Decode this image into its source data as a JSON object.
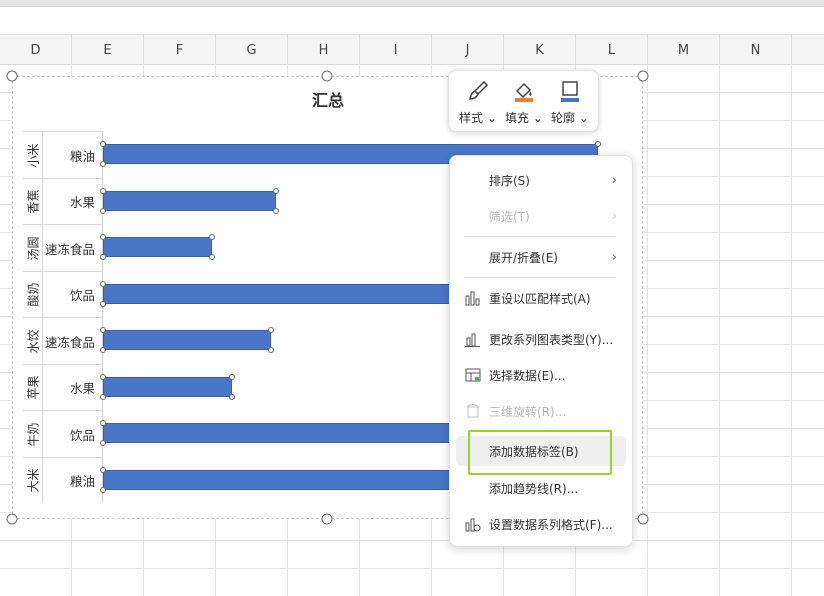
{
  "columns": [
    "D",
    "E",
    "F",
    "G",
    "H",
    "I",
    "J",
    "K",
    "L",
    "M",
    "N"
  ],
  "chart": {
    "title": "汇总",
    "groups": [
      {
        "outer": "小米",
        "inner": "粮油"
      },
      {
        "outer": "香蕉",
        "inner": "水果"
      },
      {
        "outer": "汤圆",
        "inner": "速冻食品"
      },
      {
        "outer": "酸奶",
        "inner": "饮品"
      },
      {
        "outer": "水饺",
        "inner": "速冻食品"
      },
      {
        "outer": "苹果",
        "inner": "水果"
      },
      {
        "outer": "牛奶",
        "inner": "饮品"
      },
      {
        "outer": "大米",
        "inner": "粮油"
      }
    ],
    "bar_color": "#4a76c8"
  },
  "chart_data": {
    "type": "bar",
    "title": "汇总",
    "categories": [
      "小米 粮油",
      "香蕉 水果",
      "汤圆 速冻食品",
      "酸奶 饮品",
      "水饺 速冻食品",
      "苹果 水果",
      "牛奶 饮品",
      "大米 粮油"
    ],
    "series": [
      {
        "values": [
          100,
          35,
          22,
          100,
          34,
          26,
          100,
          100
        ]
      }
    ],
    "note": ""
  },
  "float_toolbar": {
    "style": "样式",
    "fill": "填充",
    "outline": "轮廓",
    "fill_color": "#ed7d31",
    "outline_color": "#4472c4"
  },
  "context_menu": {
    "items": [
      {
        "label": "排序(S)",
        "icon": "none",
        "submenu": true,
        "disabled": false
      },
      {
        "label": "筛选(T)",
        "icon": "none",
        "submenu": true,
        "disabled": true
      },
      {
        "label": "展开/折叠(E)",
        "icon": "none",
        "submenu": true,
        "disabled": false
      },
      {
        "label": "重设以匹配样式(A)",
        "icon": "reset-style-icon",
        "submenu": false,
        "disabled": false
      },
      {
        "label": "更改系列图表类型(Y)...",
        "icon": "chart-type-icon",
        "submenu": false,
        "disabled": false
      },
      {
        "label": "选择数据(E)...",
        "icon": "select-data-icon",
        "submenu": false,
        "disabled": false
      },
      {
        "label": "三维旋转(R)...",
        "icon": "3d-rotate-icon",
        "submenu": false,
        "disabled": true
      },
      {
        "label": "添加数据标签(B)",
        "icon": "none",
        "submenu": false,
        "disabled": false
      },
      {
        "label": "添加趋势线(R)...",
        "icon": "none",
        "submenu": false,
        "disabled": false
      },
      {
        "label": "设置数据系列格式(F)...",
        "icon": "format-series-icon",
        "submenu": false,
        "disabled": false
      }
    ],
    "highlighted_item": "添加数据标签(B)",
    "highlight_color": "#9bd225"
  }
}
